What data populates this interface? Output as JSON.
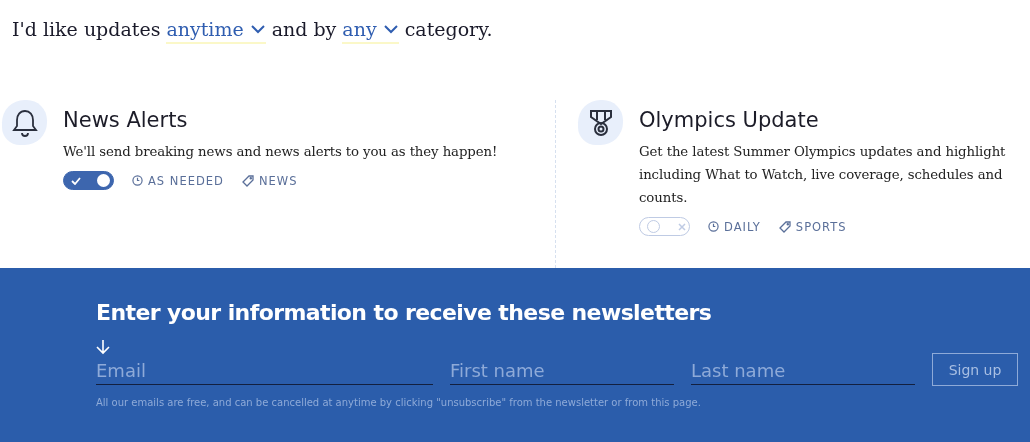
{
  "preferences": {
    "parts": [
      {
        "kind": "text",
        "text": "I'd like updates"
      },
      {
        "kind": "select",
        "text": "anytime"
      },
      {
        "kind": "text",
        "text": "and by"
      },
      {
        "kind": "select",
        "text": "any"
      },
      {
        "kind": "text",
        "text": "category."
      }
    ]
  },
  "cards": [
    {
      "kind": "bell",
      "title": "News Alerts",
      "description": [
        "We'll send breaking news and news alerts to you as they happen!"
      ],
      "on": true,
      "frequency": "AS NEEDED",
      "tag": "NEWS"
    },
    {
      "kind": "medal",
      "title": "Olympics Update",
      "description": [
        "Get the latest Summer Olympics updates and highlight",
        "including What to Watch, live coverage, schedules and",
        "counts."
      ],
      "on": false,
      "frequency": "DAILY",
      "tag": "SPORTS"
    }
  ],
  "signup": {
    "heading": "Enter your information to receive these newsletters",
    "fields": [
      {
        "placeholder": "Email",
        "arrow": true
      },
      {
        "placeholder": "First name",
        "arrow": false
      },
      {
        "placeholder": "Last name",
        "arrow": false
      }
    ],
    "button": "Sign up",
    "note": "All our emails are free, and can be cancelled at anytime by clicking \"unsubscribe\" from the newsletter or from this page."
  }
}
